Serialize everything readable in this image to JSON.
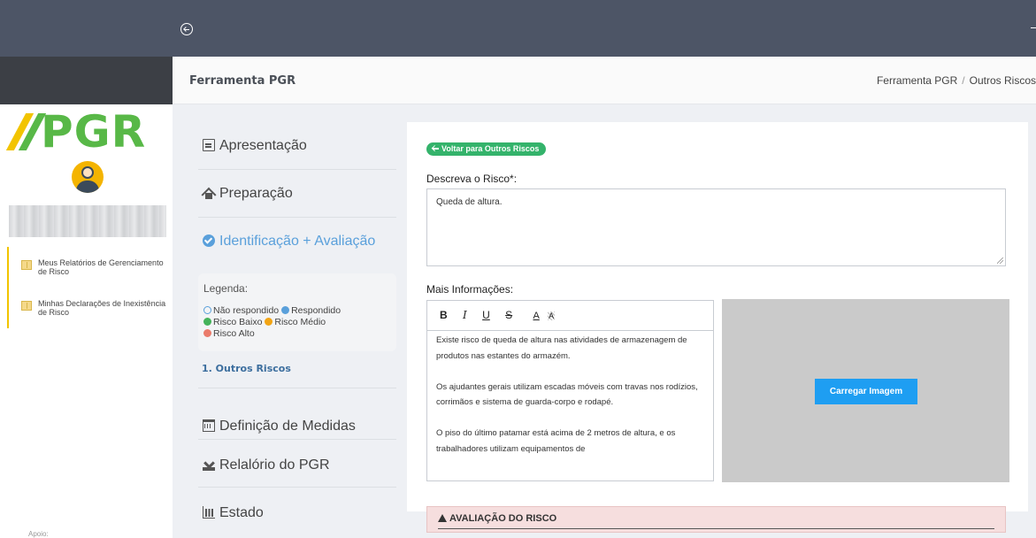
{
  "header": {
    "title": "Ferramenta PGR",
    "breadcrumb": [
      "Ferramenta PGR",
      "Outros Riscos"
    ]
  },
  "sidebar": {
    "logo_text": "PGR",
    "items": [
      {
        "label": "Meus Relatórios de Gerenciamento de Risco"
      },
      {
        "label": "Minhas Declarações de Inexistência de Risco"
      }
    ],
    "footer": "Apoio:"
  },
  "steps": [
    {
      "label": "Apresentação",
      "icon": "document-icon"
    },
    {
      "label": "Preparação",
      "icon": "home-icon"
    },
    {
      "label": "Identificação + Avaliação",
      "icon": "check-circle-icon"
    }
  ],
  "legend": {
    "title": "Legenda:",
    "items": {
      "nao_respondido": "Não respondido",
      "respondido": "Respondido",
      "baixo": "Risco Baixo",
      "medio": "Risco Médio",
      "alto": "Risco Alto"
    }
  },
  "substep": "1. Outros Riscos",
  "steps_after": [
    {
      "label": "Definição de Medidas",
      "icon": "calendar-icon"
    },
    {
      "label": "Relalório do PGR",
      "icon": "download-icon"
    },
    {
      "label": "Estado",
      "icon": "bar-chart-icon"
    }
  ],
  "form": {
    "back_label": "Voltar para Outros Riscos",
    "describe_label": "Descreva o Risco*:",
    "describe_value": "Queda de altura.",
    "more_info_label": "Mais Informações:",
    "toolbar": [
      "B",
      "I",
      "U",
      "S",
      "A",
      "A"
    ],
    "more_info_paragraphs": [
      "Existe risco de queda de altura nas atividades de armazenagem de produtos  nas estantes do armazém.",
      "Os ajudantes gerais utilizam escadas móveis com travas nos rodízios, corrimãos e sistema de guarda-corpo e rodapé.",
      "O piso do último patamar está acima de 2 metros de altura, e os trabalhadores utilizam equipamentos de"
    ],
    "upload_label": "Carregar Imagem",
    "evaluation_title": "AVALIAÇÃO DO RISCO"
  },
  "colors": {
    "topbar": "#4d5566",
    "brand_green": "#58b847",
    "brand_yellow": "#f2c400",
    "active_blue": "#5aa0db",
    "button_green": "#34b36b",
    "upload_blue": "#1e9ef2",
    "alert_bg": "#f6dede"
  }
}
